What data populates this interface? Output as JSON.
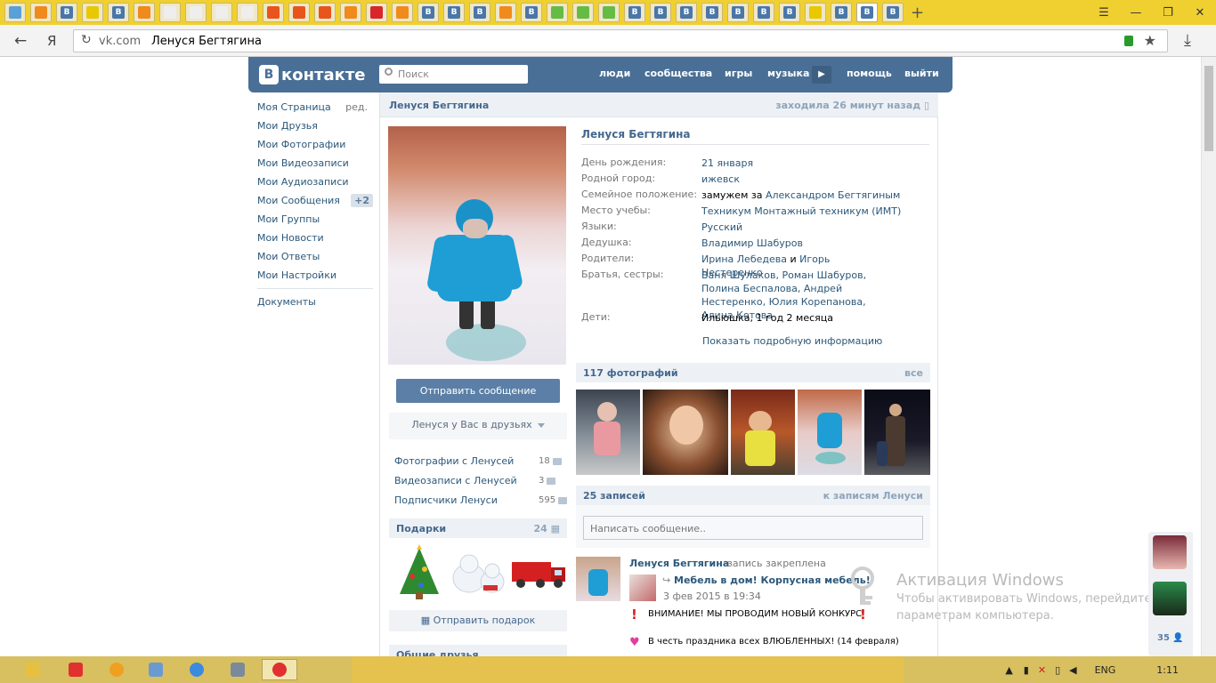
{
  "browser": {
    "tabs": [
      {
        "label": "",
        "color": "#5aa0d8"
      },
      {
        "label": "",
        "color": "#f08a1c"
      },
      {
        "label": "В",
        "color": "#4a76a8"
      },
      {
        "label": "",
        "color": "#e8c800"
      },
      {
        "label": "В",
        "color": "#4a76a8"
      },
      {
        "label": "",
        "color": "#f08a1c"
      },
      {
        "label": "",
        "color": "#eeeeee"
      },
      {
        "label": "",
        "color": "#eeeeee"
      },
      {
        "label": "",
        "color": "#eeeeee"
      },
      {
        "label": "",
        "color": "#eeeeee"
      },
      {
        "label": "",
        "color": "#e8551c"
      },
      {
        "label": "",
        "color": "#e8551c"
      },
      {
        "label": "",
        "color": "#e8551c"
      },
      {
        "label": "",
        "color": "#f08a1c"
      },
      {
        "label": "",
        "color": "#d8262b"
      },
      {
        "label": "",
        "color": "#f08a1c"
      },
      {
        "label": "В",
        "color": "#4a76a8"
      },
      {
        "label": "В",
        "color": "#4a76a8"
      },
      {
        "label": "В",
        "color": "#4a76a8"
      },
      {
        "label": "",
        "color": "#f08a1c"
      },
      {
        "label": "В",
        "color": "#4a76a8"
      },
      {
        "label": "",
        "color": "#66bb44"
      },
      {
        "label": "",
        "color": "#66bb44"
      },
      {
        "label": "",
        "color": "#66bb44"
      },
      {
        "label": "В",
        "color": "#4a76a8"
      },
      {
        "label": "В",
        "color": "#4a76a8"
      },
      {
        "label": "В",
        "color": "#4a76a8"
      },
      {
        "label": "В",
        "color": "#4a76a8"
      },
      {
        "label": "В",
        "color": "#4a76a8"
      },
      {
        "label": "В",
        "color": "#4a76a8"
      },
      {
        "label": "В",
        "color": "#4a76a8"
      },
      {
        "label": "",
        "color": "#e8c800"
      },
      {
        "label": "В",
        "color": "#4a76a8"
      },
      {
        "label": "В",
        "color": "#4a76a8",
        "active": true
      },
      {
        "label": "В",
        "color": "#4a76a8"
      }
    ],
    "new_tab": "+",
    "address_host": "vk.com",
    "address_title": "Ленуся Бегтягина",
    "reload_letter": "Я"
  },
  "vk": {
    "logo": "контакте",
    "logo_letter": "В",
    "search_placeholder": "Поиск",
    "nav": [
      "люди",
      "сообщества",
      "игры",
      "музыка",
      "помощь",
      "выйти"
    ]
  },
  "menu": {
    "edit": "ред.",
    "items": [
      {
        "label": "Моя Страница"
      },
      {
        "label": "Мои Друзья"
      },
      {
        "label": "Мои Фотографии"
      },
      {
        "label": "Мои Видеозаписи"
      },
      {
        "label": "Мои Аудиозаписи"
      },
      {
        "label": "Мои Сообщения",
        "badge": "+2"
      },
      {
        "label": "Мои Группы"
      },
      {
        "label": "Мои Новости"
      },
      {
        "label": "Мои Ответы"
      },
      {
        "label": "Мои Настройки"
      }
    ],
    "docs": "Документы"
  },
  "profile": {
    "header_name": "Ленуся Бегтягина",
    "last_seen": "заходила 26 минут назад",
    "name": "Ленуся Бегтягина",
    "send_message": "Отправить сообщение",
    "friend_status": "Ленуся у Вас в друзьях",
    "side_links": [
      {
        "label": "Фотографии с Ленусей",
        "count": "18"
      },
      {
        "label": "Видеозаписи с Ленусей",
        "count": "3"
      },
      {
        "label": "Подписчики Ленуси",
        "count": "595"
      }
    ],
    "gifts_title": "Подарки",
    "gifts_count": "24",
    "send_gift": "Отправить подарок",
    "common_friends": "Общие друзья",
    "info": [
      {
        "label": "День рождения:",
        "value": "21 января"
      },
      {
        "label": "Родной город:",
        "value": "ижевск"
      },
      {
        "label": "Семейное положение:",
        "prefix": "замужем за ",
        "value": "Александром Бегтягиным"
      },
      {
        "label": "Место учебы:",
        "value": "Техникум Монтажный техникум (ИМТ)"
      },
      {
        "label": "Языки:",
        "value": "Русский"
      },
      {
        "label": "Дедушка:",
        "value": "Владимир Шабуров"
      },
      {
        "label": "Родители:",
        "value": "Ирина Лебедева",
        "conj": " и ",
        "value2": "Игорь Нестеренко"
      },
      {
        "label": "Братья, сестры:",
        "value": "Ваня Шулаков, Роман Шабуров, Полина Беспалова, Андрей Нестеренко, Юлия Корепанова, Алина Котова"
      },
      {
        "label": "Дети:",
        "value": "Ильюшка, 1 год 2 месяца"
      }
    ],
    "show_more": "Показать подробную информацию",
    "photos_title": "117 фотографий",
    "photos_all": "все",
    "wall_title": "25 записей",
    "wall_link": "к записям Ленуси",
    "wall_placeholder": "Написать сообщение..",
    "post": {
      "author": "Ленуся Бегтягина",
      "pinned": "запись закреплена",
      "repost_title": "Мебель в дом! Корпусная мебель!",
      "date": "3 фев 2015 в 19:34",
      "line1": "ВНИМАНИЕ! МЫ ПРОВОДИМ НОВЫЙ КОНКУРС",
      "line2": "В честь праздника всех ВЛЮБЛЕННЫХ! (14 февраля)"
    }
  },
  "windows": {
    "activation_title": "Активация Windows",
    "activation_line1": "Чтобы активировать Windows, перейдите",
    "activation_line2": "параметрам компьютера."
  },
  "right_friends_count": "35",
  "taskbar": {
    "lang": "ENG",
    "time": "1:11"
  }
}
